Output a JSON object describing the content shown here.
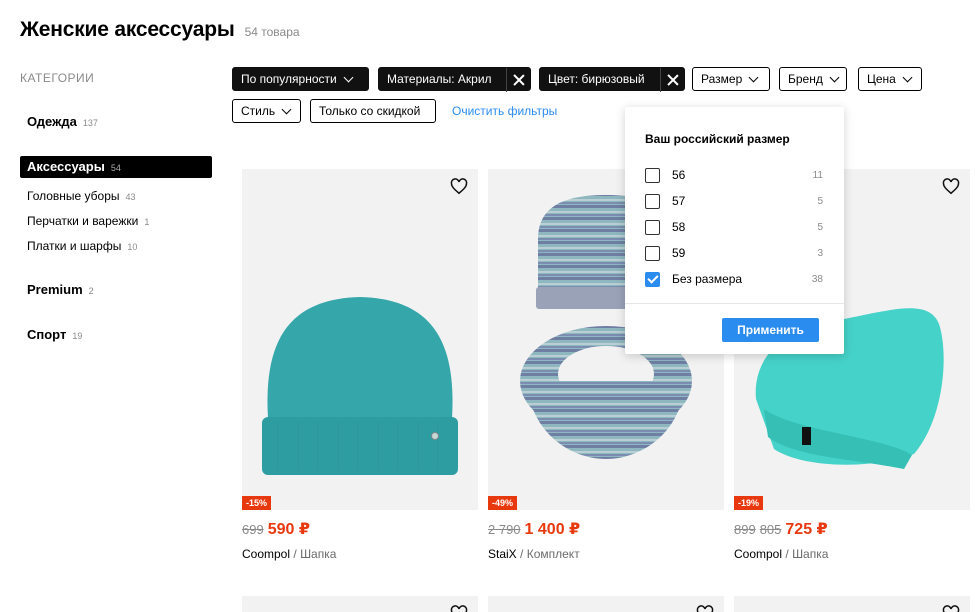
{
  "header": {
    "title": "Женские аксессуары",
    "count": "54 товара"
  },
  "sidebar": {
    "heading": "Категории",
    "items": [
      {
        "label": "Одежда",
        "count": "137"
      },
      {
        "label": "Аксессуары",
        "count": "54"
      },
      {
        "label": "Головные уборы",
        "count": "43"
      },
      {
        "label": "Перчатки и варежки",
        "count": "1"
      },
      {
        "label": "Платки и шарфы",
        "count": "10"
      },
      {
        "label": "Premium",
        "count": "2"
      },
      {
        "label": "Спорт",
        "count": "19"
      }
    ]
  },
  "filters": {
    "sort": "По популярности",
    "material": "Материалы: Акрил",
    "color": "Цвет: бирюзовый",
    "size": "Размер",
    "brand": "Бренд",
    "price": "Цена",
    "style": "Стиль",
    "discount_only": "Только со скидкой",
    "clear": "Очистить фильтры"
  },
  "size_dropdown": {
    "title": "Ваш российский размер",
    "options": [
      {
        "label": "56",
        "count": "11",
        "checked": false
      },
      {
        "label": "57",
        "count": "5",
        "checked": false
      },
      {
        "label": "58",
        "count": "5",
        "checked": false
      },
      {
        "label": "59",
        "count": "3",
        "checked": false
      },
      {
        "label": "Без размера",
        "count": "38",
        "checked": true
      }
    ],
    "apply": "Применить"
  },
  "products": [
    {
      "discount": "-15%",
      "old_price": "699",
      "old_price_2": "",
      "price": "590 ₽",
      "brand": "Coompol",
      "separator": "/",
      "type": "Шапка",
      "image": "teal-beanie"
    },
    {
      "discount": "-49%",
      "old_price": "2 790",
      "old_price_2": "",
      "price": "1 400 ₽",
      "brand": "StaiX",
      "separator": "/",
      "type": "Комплект",
      "image": "striped-hat-and-snood"
    },
    {
      "discount": "-19%",
      "old_price": "899",
      "old_price_2": "805",
      "price": "725 ₽",
      "brand": "Coompol",
      "separator": "/",
      "type": "Шапка",
      "image": "mint-slouchy-beanie"
    }
  ],
  "colors": {
    "accent": "#2b8cf0",
    "sale": "#e8380d",
    "image_bg": "#f2f2f2",
    "teal": "#2fa3a8",
    "mint": "#3fd0c6"
  }
}
